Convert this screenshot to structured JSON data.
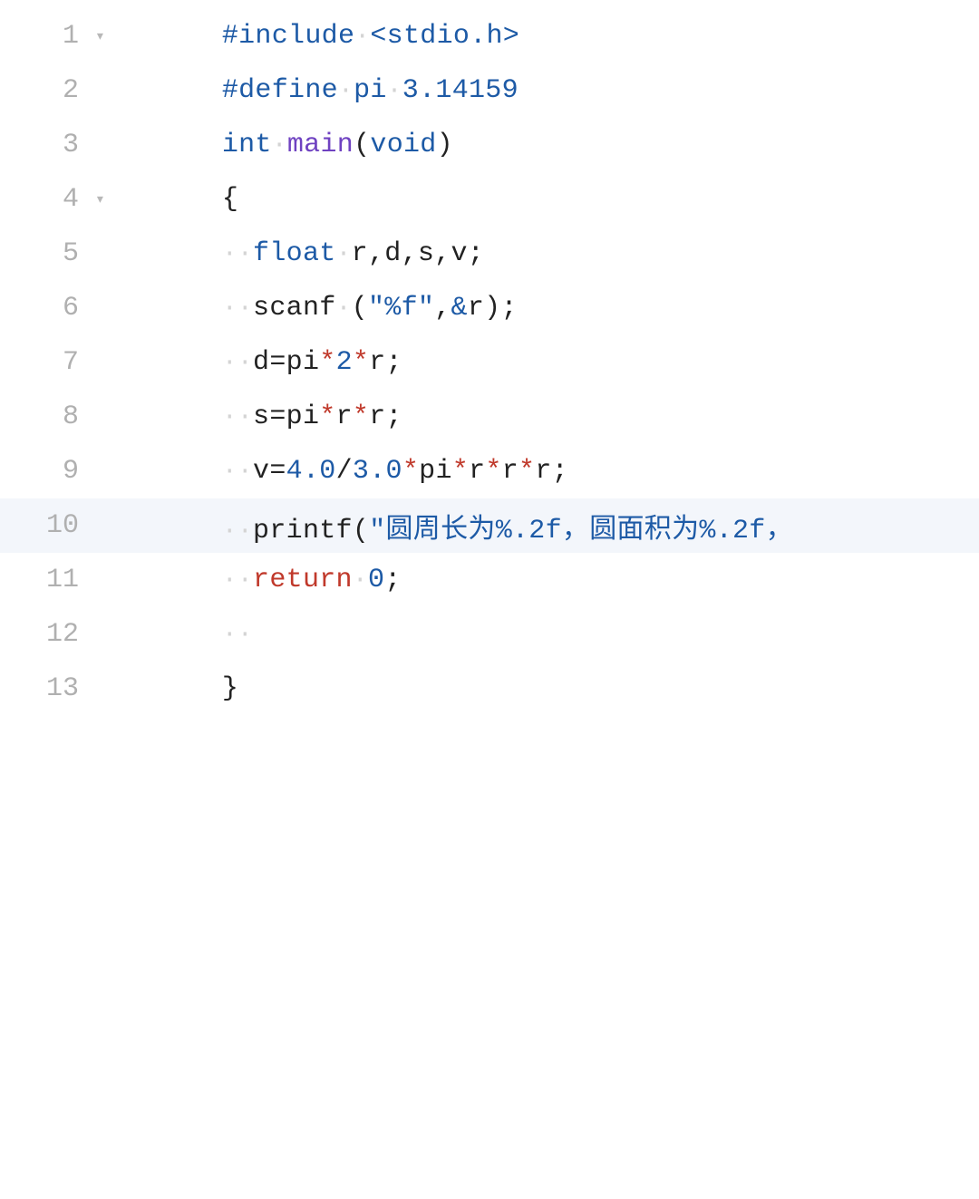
{
  "lines": [
    {
      "num": "1",
      "fold": "▾"
    },
    {
      "num": "2",
      "fold": ""
    },
    {
      "num": "3",
      "fold": ""
    },
    {
      "num": "4",
      "fold": "▾"
    },
    {
      "num": "5",
      "fold": ""
    },
    {
      "num": "6",
      "fold": ""
    },
    {
      "num": "7",
      "fold": ""
    },
    {
      "num": "8",
      "fold": ""
    },
    {
      "num": "9",
      "fold": ""
    },
    {
      "num": "10",
      "fold": ""
    },
    {
      "num": "11",
      "fold": ""
    },
    {
      "num": "12",
      "fold": ""
    },
    {
      "num": "13",
      "fold": ""
    }
  ],
  "tokens": {
    "l1": {
      "include": "#include",
      "ws": "·",
      "header": "<stdio.h>"
    },
    "l2": {
      "define": "#define",
      "ws1": "·",
      "name": "pi",
      "ws2": "·",
      "val": "3.14159"
    },
    "l3": {
      "int": "int",
      "ws": "·",
      "main": "main",
      "lp": "(",
      "void": "void",
      "rp": ")"
    },
    "l4": {
      "brace": "{"
    },
    "l5": {
      "ws": "··",
      "float": "float",
      "sp": "·",
      "vars": "r,d,s,v",
      "semi": ";"
    },
    "l6": {
      "ws": "··",
      "scanf": "scanf",
      "sp": "·",
      "lp": "(",
      "fmt": "\"%f\"",
      "comma": ",",
      "amp": "&",
      "r": "r",
      "rp": ")",
      "semi": ";"
    },
    "l7": {
      "ws": "··",
      "d": "d",
      "eq": "=",
      "pi": "pi",
      "s1": "*",
      "two": "2",
      "s2": "*",
      "r": "r",
      "semi": ";"
    },
    "l8": {
      "ws": "··",
      "s": "s",
      "eq": "=",
      "pi": "pi",
      "s1": "*",
      "r1": "r",
      "s2": "*",
      "r2": "r",
      "semi": ";"
    },
    "l9": {
      "ws": "··",
      "v": "v",
      "eq": "=",
      "n1": "4.0",
      "slash": "/",
      "n2": "3.0",
      "s1": "*",
      "pi": "pi",
      "s2": "*",
      "r1": "r",
      "s3": "*",
      "r2": "r",
      "s4": "*",
      "r3": "r",
      "semi": ";"
    },
    "l10": {
      "ws": "··",
      "printf": "printf",
      "lp": "(",
      "str": "\"圆周长为%.2f，圆面积为%.2f，"
    },
    "l11": {
      "ws": "··",
      "return": "return",
      "sp": "·",
      "zero": "0",
      "semi": ";"
    },
    "l12": {
      "ws": "··"
    },
    "l13": {
      "brace": "}"
    }
  }
}
